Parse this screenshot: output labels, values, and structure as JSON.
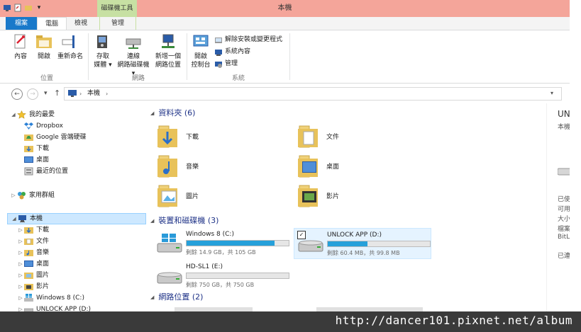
{
  "titlebar": {
    "title": "本機",
    "context_tab_group": "磁碟機工具"
  },
  "tabs": {
    "file": "檔案",
    "computer": "電腦",
    "view": "檢視",
    "manage": "管理"
  },
  "ribbon": {
    "location_group": {
      "label": "位置",
      "properties": "內容",
      "open": "開啟",
      "rename": "重新命名"
    },
    "network_group": {
      "label": "網路",
      "access_media_1": "存取",
      "access_media_2": "媒體",
      "map_drive_1": "連線",
      "map_drive_2": "網路磁碟機",
      "add_location_1": "新增一個",
      "add_location_2": "網路位置"
    },
    "system_group": {
      "label": "系統",
      "control_panel_1": "開啟",
      "control_panel_2": "控制台",
      "uninstall": "解除安裝或變更程式",
      "system_properties": "系統內容",
      "manage": "管理"
    }
  },
  "address": {
    "crumb": "本機",
    "search_placeholder": ""
  },
  "nav": {
    "favorites": "我的最愛",
    "dropbox": "Dropbox",
    "google_drive": "Google 雲端硬碟",
    "downloads": "下載",
    "desktop": "桌面",
    "recent": "最近的位置",
    "homegroup": "家用群組",
    "this_pc": "本機",
    "pc_downloads": "下載",
    "pc_documents": "文件",
    "pc_music": "音樂",
    "pc_desktop": "桌面",
    "pc_pictures": "圖片",
    "pc_videos": "影片",
    "pc_c": "Windows 8 (C:)",
    "pc_d": "UNLOCK APP (D:)"
  },
  "content": {
    "folders_header": "資料夾 (6)",
    "folders": [
      {
        "name": "下載"
      },
      {
        "name": "文件"
      },
      {
        "name": "音樂"
      },
      {
        "name": "桌面"
      },
      {
        "name": "圖片"
      },
      {
        "name": "影片"
      }
    ],
    "devices_header": "裝置和磁碟機 (3)",
    "drives": [
      {
        "name": "Windows 8 (C:)",
        "free": "剩餘 14.9 GB，共 105 GB",
        "used_fraction": 0.86
      },
      {
        "name": "UNLOCK APP (D:)",
        "free": "剩餘 60.4 MB，共 99.8 MB",
        "used_fraction": 0.39
      },
      {
        "name": "HD-SL1 (E:)",
        "free": "剩餘 750 GB，共 750 GB",
        "used_fraction": 0.0
      }
    ],
    "network_header": "網路位置 (2)"
  },
  "details": {
    "l1": "UN",
    "l2": "本機",
    "l3": "已使",
    "l4": "可用",
    "l5": "大小",
    "l6": "檔案",
    "l7": "BitL",
    "l8": "已連"
  },
  "watermark": "http://dancer101.pixnet.net/album",
  "colors": {
    "titlebar": "#f4a59a",
    "context_tab": "#c7e0a3",
    "file_tab": "#1979ca",
    "drive_bar": "#26a0da",
    "section_header": "#1e3287"
  }
}
